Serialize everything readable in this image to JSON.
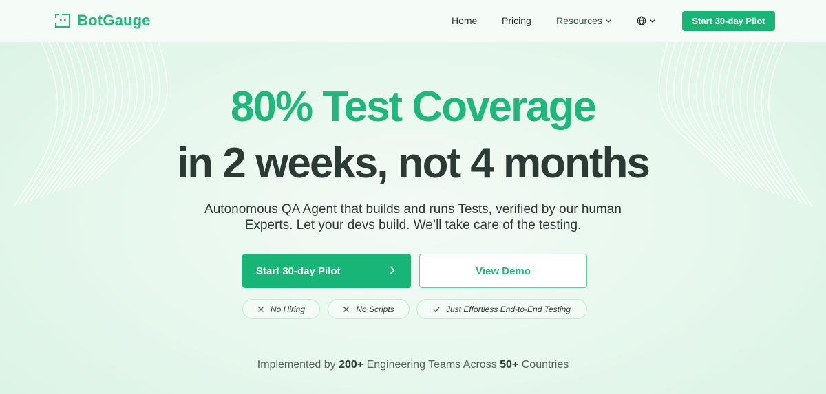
{
  "brand": {
    "name": "BotGauge",
    "accent": "#1db87a",
    "dark_text": "#2c3a36",
    "logo_icon": "bot-face-icon"
  },
  "nav": {
    "home": "Home",
    "pricing": "Pricing",
    "resources": "Resources",
    "language_icon": "globe-icon",
    "cta": "Start 30-day Pilot"
  },
  "hero": {
    "headline_1": "80% Test Coverage",
    "headline_2": "in 2 weeks, not 4 months",
    "subtitle_line_1": "Autonomous QA Agent that builds and runs Tests, verified by our human",
    "subtitle_line_2": "Experts. Let your devs build. We’ll take care of the testing.",
    "primary_cta": "Start 30-day Pilot",
    "secondary_cta": "View Demo"
  },
  "pills": [
    {
      "label": "No Hiring",
      "icon": "x-icon"
    },
    {
      "label": "No Scripts",
      "icon": "x-icon"
    },
    {
      "label": "Just Effortless End-to-End Testing",
      "icon": "check-icon"
    }
  ],
  "social_proof": {
    "prefix": "Implemented by",
    "teams": "200+",
    "middle": "Engineering Teams Across",
    "countries": "50+",
    "suffix": "Countries"
  }
}
